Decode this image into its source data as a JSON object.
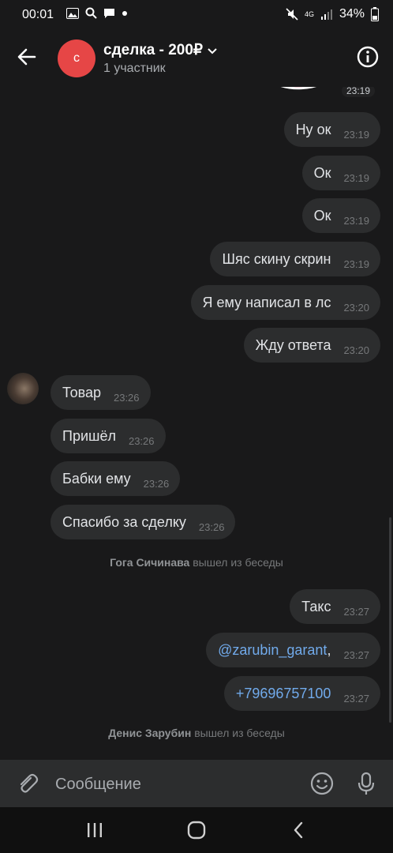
{
  "status_bar": {
    "time": "00:01",
    "battery": "34%",
    "network": "4G",
    "icons": [
      "gallery-icon",
      "search-icon",
      "chat-icon",
      "dot-icon",
      "mute-icon",
      "signal-icon",
      "battery-icon"
    ]
  },
  "header": {
    "avatar_letter": "с",
    "avatar_color": "#e64646",
    "title": "сделка - 200₽",
    "subtitle": "1 участник"
  },
  "messages": [
    {
      "side": "out",
      "kind": "sticker",
      "time": "23:19"
    },
    {
      "side": "out",
      "text": "Ну ок",
      "time": "23:19"
    },
    {
      "side": "out",
      "text": "Ок",
      "time": "23:19"
    },
    {
      "side": "out",
      "text": "Ок",
      "time": "23:19"
    },
    {
      "side": "out",
      "text": "Шяс скину скрин",
      "time": "23:19"
    },
    {
      "side": "out",
      "text": "Я ему написал в лс",
      "time": "23:20"
    },
    {
      "side": "out",
      "text": "Жду ответа",
      "time": "23:20"
    },
    {
      "side": "in",
      "text": "Товар",
      "time": "23:26"
    },
    {
      "side": "in",
      "text": "Пришёл",
      "time": "23:26"
    },
    {
      "side": "in",
      "text": "Бабки ему",
      "time": "23:26"
    },
    {
      "side": "in",
      "text": "Спасибо за сделку",
      "time": "23:26"
    },
    {
      "side": "system",
      "name": "Гога Сичинава",
      "action": "вышел из беседы"
    },
    {
      "side": "out",
      "text": "Такс",
      "time": "23:27"
    },
    {
      "side": "out",
      "link": "@zarubin_garant",
      "suffix": ",",
      "time": "23:27"
    },
    {
      "side": "out",
      "link": "+79696757100",
      "time": "23:27"
    },
    {
      "side": "system",
      "name": "Денис Зарубин",
      "action": "вышел из беседы"
    }
  ],
  "composer": {
    "placeholder": "Сообщение"
  },
  "colors": {
    "background": "#19191a",
    "bubble": "#2c2d2e",
    "link": "#71aaeb",
    "muted": "#76787a"
  }
}
